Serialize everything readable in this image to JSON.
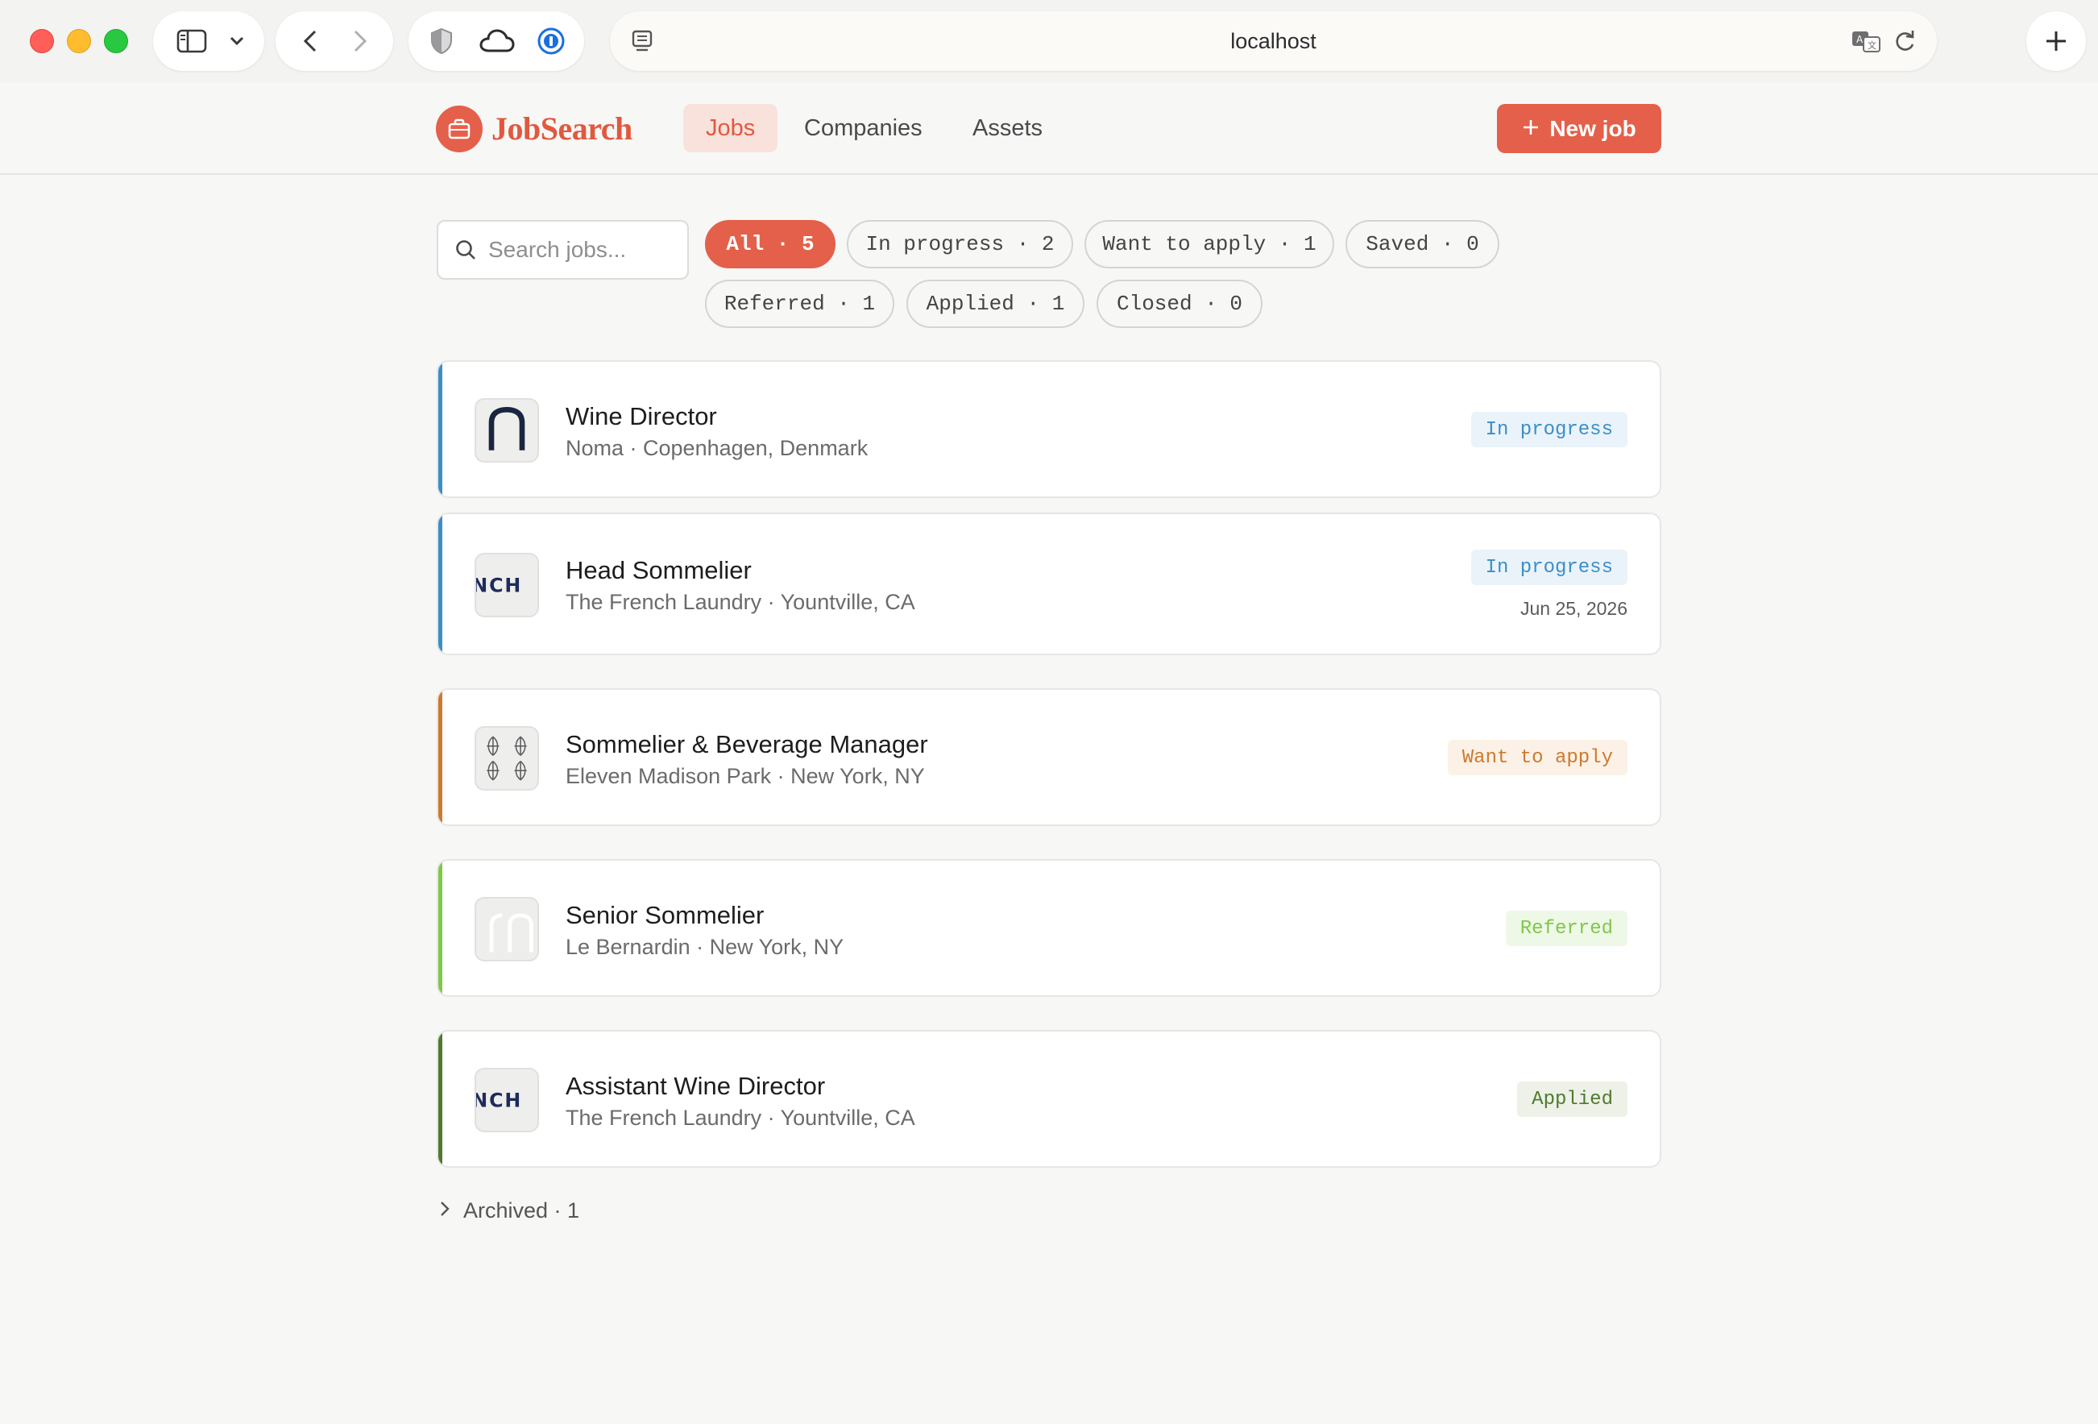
{
  "browser": {
    "url": "localhost"
  },
  "app": {
    "logo_text": "JobSearch",
    "nav": [
      {
        "label": "Jobs"
      },
      {
        "label": "Companies"
      },
      {
        "label": "Assets"
      }
    ],
    "new_job_label": "New job",
    "accent_color": "#e4604a"
  },
  "filters": {
    "search_placeholder": "Search jobs...",
    "chips": [
      {
        "label": "All · 5",
        "active": true
      },
      {
        "label": "In progress · 2"
      },
      {
        "label": "Want to apply · 1"
      },
      {
        "label": "Saved · 0"
      },
      {
        "label": "Referred · 1"
      },
      {
        "label": "Applied · 1"
      },
      {
        "label": "Closed · 0"
      }
    ]
  },
  "jobs": [
    {
      "title": "Wine Director",
      "subtitle": "Noma · Copenhagen, Denmark",
      "status": "In progress",
      "status_color": "#3a8fc7",
      "logo": "n"
    },
    {
      "title": "Head Sommelier",
      "subtitle": "The French Laundry · Yountville, CA",
      "status": "In progress",
      "status_color": "#3a8fc7",
      "date": "Jun 25, 2026",
      "logo": "NCH"
    },
    {
      "title": "Sommelier & Beverage Manager",
      "subtitle": "Eleven Madison Park · New York, NY",
      "status": "Want to apply",
      "status_color": "#cc7a2e",
      "logo": "leaf-pattern"
    },
    {
      "title": "Senior Sommelier",
      "subtitle": "Le Bernardin · New York, NY",
      "status": "Referred",
      "status_color": "#7ec84a",
      "logo": "rr"
    },
    {
      "title": "Assistant Wine Director",
      "subtitle": "The French Laundry · Yountville, CA",
      "status": "Applied",
      "status_color": "#4f7a2e",
      "logo": "NCH"
    }
  ],
  "archived_label": "Archived · 1"
}
